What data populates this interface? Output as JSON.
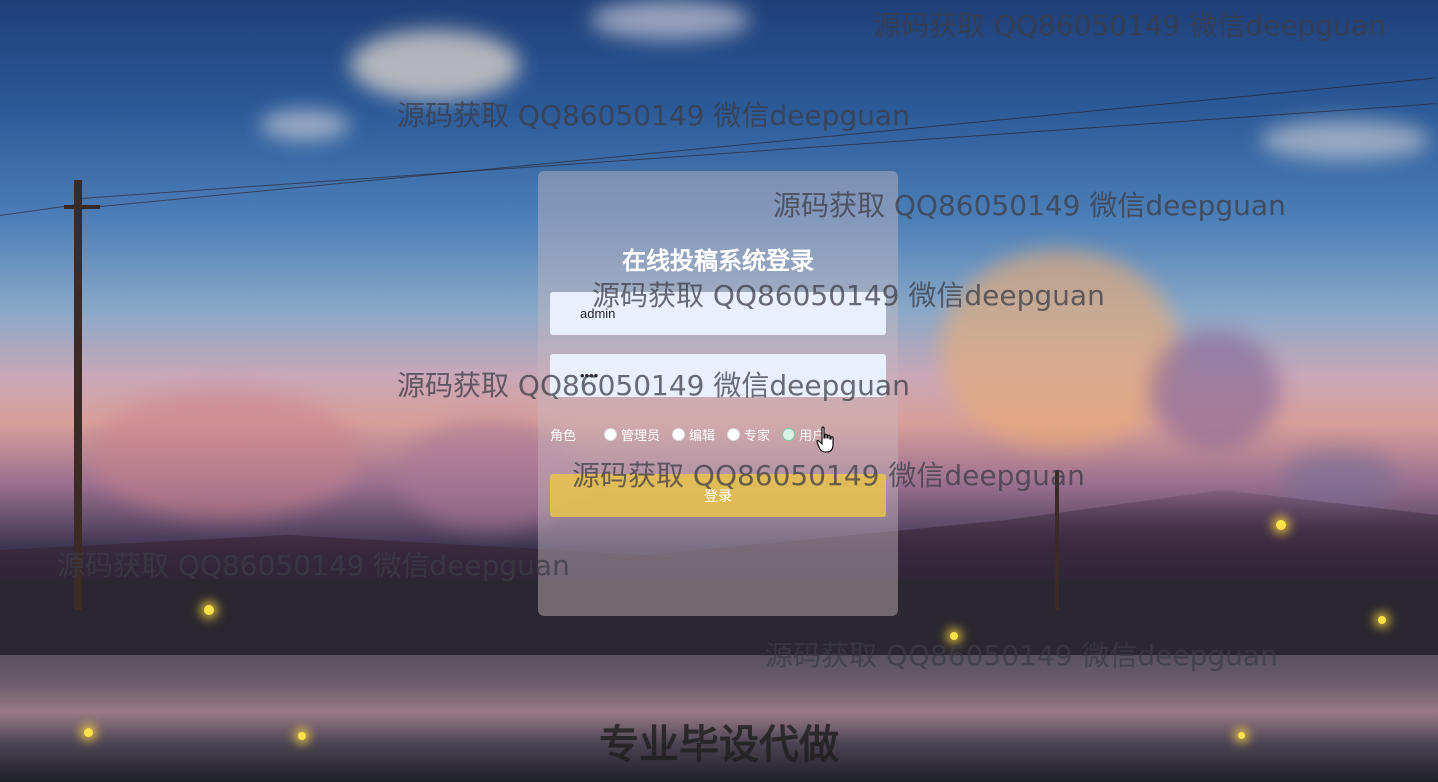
{
  "login": {
    "title": "在线投稿系统登录",
    "username_value": "admin",
    "password_value": "••••",
    "role_label": "角色",
    "roles": [
      "管理员",
      "编辑",
      "专家",
      "用户"
    ],
    "submit_label": "登录"
  },
  "watermark": {
    "text": "源码获取 QQ86050149 微信deepguan"
  },
  "footer": {
    "text": "专业毕设代做"
  }
}
